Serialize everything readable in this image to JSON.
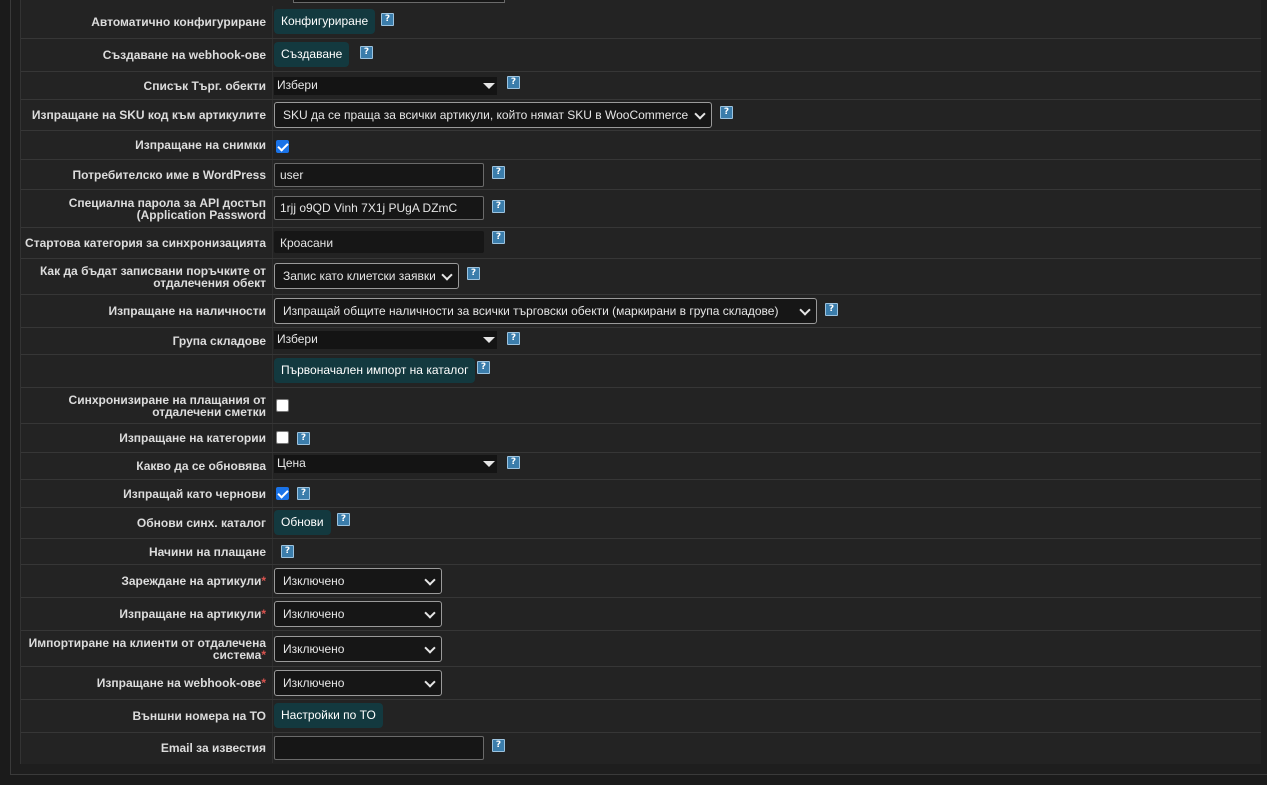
{
  "help_glyph": "?",
  "rows": {
    "auto_config": {
      "label": "Автоматично конфигуриране",
      "button": "Конфигуриране"
    },
    "create_webhooks": {
      "label": "Създаване на webhook-ове",
      "button": "Създаване"
    },
    "store_list": {
      "label": "Списък Търг. обекти",
      "value": "Избери"
    },
    "send_sku": {
      "label": "Изпращане на SKU код към артикулите",
      "value": "SKU да се праща за всички артикули, който нямат SKU в WooCommerce"
    },
    "send_images": {
      "label": "Изпращане на снимки",
      "checked": true
    },
    "wp_user": {
      "label": "Потребителско име в WordPress",
      "value": "user"
    },
    "api_password": {
      "label_line1": "Специална парола за API достъп",
      "label_line2": "(Application Password",
      "value": "1rjj o9QD Vinh 7X1j PUgA DZmC"
    },
    "start_category": {
      "label": "Стартова категория за синхронизацията",
      "value": "Кроасани"
    },
    "order_record": {
      "label_line1": "Как да бъдат записвани поръчките от",
      "label_line2": "отдалечения обект",
      "value": "Запис като клиетски заявки"
    },
    "send_stock": {
      "label": "Изпращане на наличности",
      "value": "Изпращай общите наличности за всички търговски обекти (маркирани в група складове)"
    },
    "warehouse_group": {
      "label": "Група складове",
      "value": "Избери"
    },
    "initial_import": {
      "button": "Първоначален импорт на каталог"
    },
    "sync_payments": {
      "label_line1": "Синхронизиране на плащания от",
      "label_line2": "отдалечени сметки",
      "checked": false
    },
    "send_categories": {
      "label": "Изпращане на категории",
      "checked": false
    },
    "what_update": {
      "label": "Какво да се обновява",
      "value": "Цена"
    },
    "send_draft": {
      "label": "Изпращай като чернови",
      "checked": true
    },
    "refresh_catalog": {
      "label": "Обнови синх. каталог",
      "button": "Обнови"
    },
    "payment_methods": {
      "label": "Начини на плащане"
    },
    "load_items": {
      "label": "Зареждане на артикули",
      "value": "Изключено"
    },
    "send_items": {
      "label": "Изпращане на артикули",
      "value": "Изключено"
    },
    "import_clients": {
      "label_line1": "Импортиране на клиенти от отдалечена",
      "label_line2": "система",
      "value": "Изключено"
    },
    "send_webhooks": {
      "label": "Изпращане на webhook-ове",
      "value": "Изключено"
    },
    "external_numbers": {
      "label": "Външни номера на ТО",
      "button": "Настройки по ТО"
    },
    "email_notify": {
      "label": "Email за известия",
      "value": ""
    }
  },
  "colors": {
    "button_bg": "#13393f",
    "checkbox_checked": "#1a73e8",
    "required": "#d9534f",
    "help_icon": "#3b7dab"
  }
}
